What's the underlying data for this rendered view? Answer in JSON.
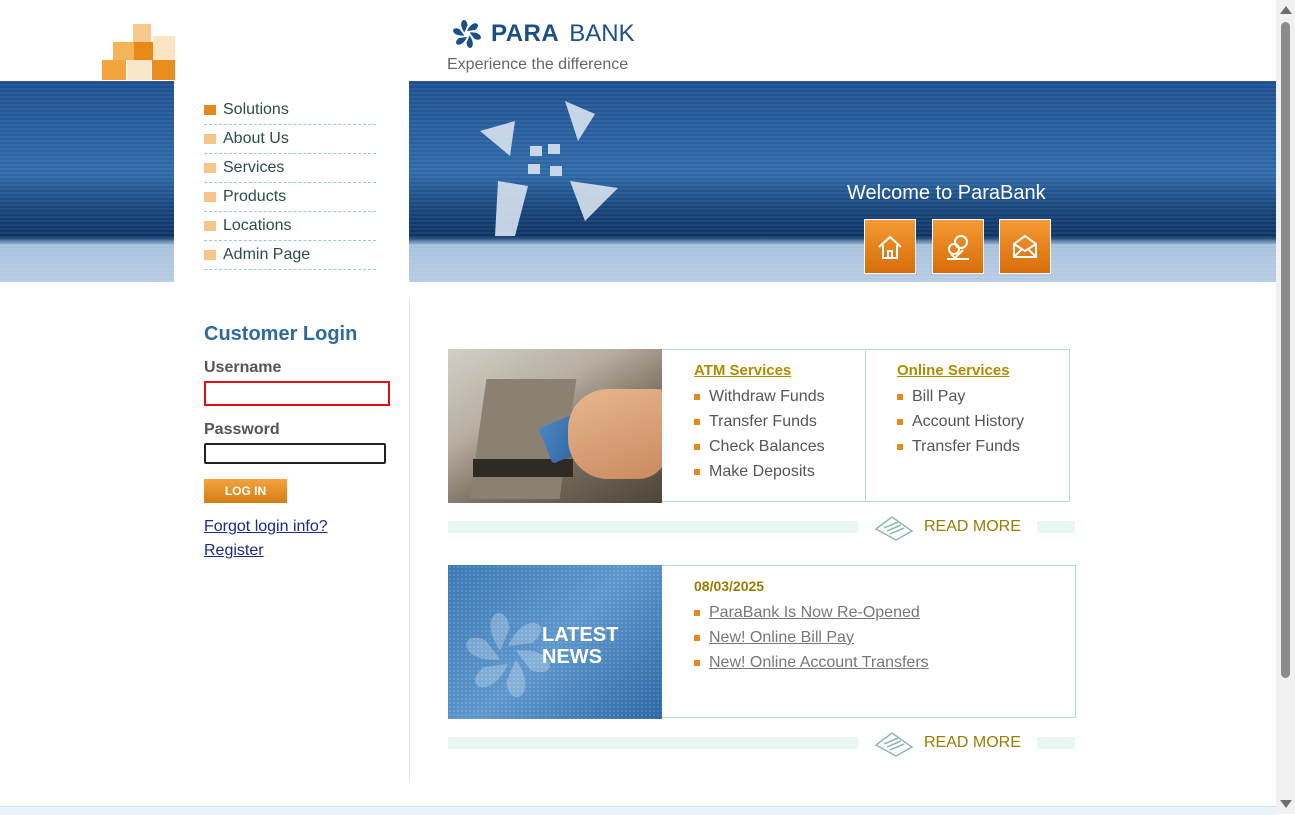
{
  "header": {
    "brand_left": "PARA",
    "brand_right": "BANK",
    "tagline": "Experience the difference",
    "logo_icon": "pinwheel-logo-icon"
  },
  "nav": {
    "items": [
      {
        "label": "Solutions",
        "active": true
      },
      {
        "label": "About Us"
      },
      {
        "label": "Services"
      },
      {
        "label": "Products"
      },
      {
        "label": "Locations"
      },
      {
        "label": "Admin Page"
      }
    ]
  },
  "banner": {
    "welcome": "Welcome to ParaBank",
    "buttons": [
      "home-icon",
      "contact-icon",
      "mail-icon"
    ]
  },
  "login": {
    "title": "Customer Login",
    "username_label": "Username",
    "username_value": "",
    "password_label": "Password",
    "password_value": "",
    "button": "LOG IN",
    "forgot": "Forgot login info?",
    "register": "Register"
  },
  "services": {
    "atm_title": "ATM Services",
    "atm_items": [
      "Withdraw Funds",
      "Transfer Funds",
      "Check Balances",
      "Make Deposits"
    ],
    "online_title": "Online Services",
    "online_items": [
      "Bill Pay",
      "Account History",
      "Transfer Funds"
    ],
    "read_more": "READ MORE"
  },
  "news": {
    "image_text_1": "LATEST",
    "image_text_2": "NEWS",
    "date": "08/03/2025",
    "items": [
      "ParaBank Is Now Re-Opened",
      "New! Online Bill Pay",
      "New! Online Account Transfers"
    ],
    "read_more": "READ MORE"
  },
  "colors": {
    "accent": "#e48a1d",
    "brand_blue": "#1a4f8a",
    "gold": "#9a7c00"
  }
}
